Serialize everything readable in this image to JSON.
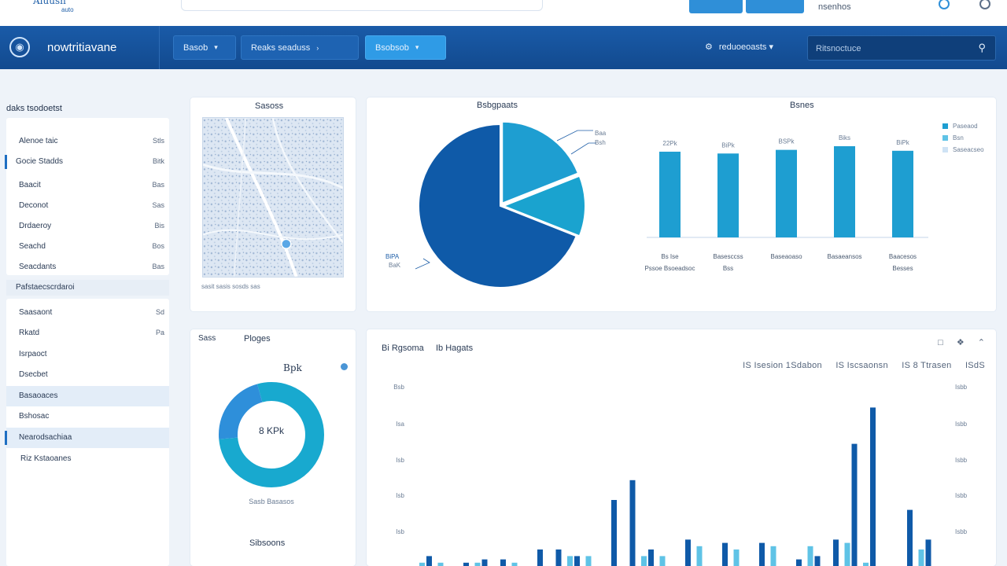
{
  "topbar": {
    "brand_mark": "Aiuusn",
    "brand_sub": "auto",
    "user_label": "nsenhos"
  },
  "navbar": {
    "title": "nowtritiavane",
    "tabs": [
      {
        "label": "Basob"
      },
      {
        "label": "Reaks seaduss"
      },
      {
        "label": "Bsobsob"
      }
    ],
    "filter_label": "reduoeoasts",
    "search_placeholder": "Ritsnoctuce"
  },
  "sidebar": {
    "heading": "daks tsodoetst",
    "items_top": [
      {
        "label": "Alenoe taic",
        "value": "Stls"
      },
      {
        "label": "Gocie Stadds",
        "value": "Bitk"
      },
      {
        "label": "Baacit",
        "value": "Bas"
      },
      {
        "label": "Deconot",
        "value": "Sas"
      },
      {
        "label": "Drdaeroy",
        "value": "Bis"
      },
      {
        "label": "Seachd",
        "value": "Bos"
      },
      {
        "label": "Seacdants",
        "value": "Bas"
      }
    ],
    "section": "Pafstaecscrdaroi",
    "items_bottom": [
      {
        "label": "Saasaont",
        "value": "Sd"
      },
      {
        "label": "Rkatd",
        "value": "Pa"
      },
      {
        "label": "Isrpaoct",
        "value": ""
      },
      {
        "label": "Dsecbet",
        "value": ""
      },
      {
        "label": "Basaoaces",
        "value": ""
      },
      {
        "label": "Bshosac",
        "value": ""
      },
      {
        "label": "Nearodsachiaa",
        "value": ""
      },
      {
        "label": "Riz Kstaoanes",
        "value": ""
      }
    ]
  },
  "map_card": {
    "title": "Sasoss",
    "caption": "sasit sasis sosds sas"
  },
  "pie_card": {
    "title": "Bsbgpaats",
    "callout_top": [
      "Baa",
      "Bsh"
    ],
    "callout_bottom": [
      "BiPA",
      "BaK"
    ]
  },
  "bar_card": {
    "title": "Bsnes",
    "legend": [
      "Paseaod",
      "Bsn",
      "Saseacseo"
    ]
  },
  "donut_card": {
    "tabs": [
      "Sass",
      "Ploges"
    ],
    "top_label": "Bpk",
    "center_label": "8 KPk",
    "caption": "Sasb Basasos",
    "footer": "Sibsoons"
  },
  "big_card": {
    "title_a": "Bi Rgsoma",
    "title_b": "Ib Hagats",
    "stats": [
      "IS Isesion 1Sdabon",
      "IS Iscsaonsn",
      "IS 8 Ttrasen",
      "ISdS"
    ]
  },
  "chart_data": [
    {
      "type": "pie",
      "title": "Bsbgpaats",
      "slices": [
        {
          "label": "",
          "value": 69,
          "color": "#0f5aa8"
        },
        {
          "label": "",
          "value": 19,
          "color": "#1e9ed1"
        },
        {
          "label": "",
          "value": 12,
          "color": "#1aa3cf"
        }
      ]
    },
    {
      "type": "bar",
      "title": "Bsnes",
      "categories": [
        "Bs Ise Pssoe Bsoeadsoc",
        "Basesccss Bss",
        "Baseaoaso",
        "Basaeansos",
        "Baacesos Besses"
      ],
      "values": [
        94,
        92,
        96,
        100,
        95
      ],
      "value_labels": [
        "22Pk",
        "BiPk",
        "BSPk",
        "Biks",
        "BiPk"
      ],
      "color": "#1e9ed1"
    },
    {
      "type": "pie",
      "title": "",
      "donut": true,
      "slices": [
        {
          "label": "",
          "value": 78,
          "color": "#18a9cf"
        },
        {
          "label": "",
          "value": 22,
          "color": "#2e8fda"
        }
      ]
    },
    {
      "type": "bar",
      "title": "Bi Rgsoma Ib Hagats",
      "y_left_ticks": [
        "Bsb",
        "Isa",
        "Isb",
        "Isb",
        "Isb"
      ],
      "y_right_ticks": [
        "Isbb",
        "Isbb",
        "Isbb",
        "Isbb",
        "Isbb"
      ],
      "series": [
        {
          "name": "",
          "color": "#0f5aa8",
          "values": [
            3,
            0,
            1,
            2,
            2,
            0,
            5,
            5,
            3,
            0,
            20,
            26,
            5,
            0,
            8,
            0,
            7,
            0,
            7,
            0,
            2,
            3,
            8,
            37,
            48,
            0,
            17,
            8
          ]
        },
        {
          "name": "",
          "color": "#5fc3e6",
          "values": [
            1,
            1,
            0,
            1,
            0,
            1,
            0,
            0,
            3,
            3,
            0,
            0,
            3,
            3,
            0,
            6,
            0,
            5,
            0,
            6,
            0,
            6,
            0,
            7,
            1,
            0,
            0,
            5
          ]
        }
      ]
    }
  ]
}
